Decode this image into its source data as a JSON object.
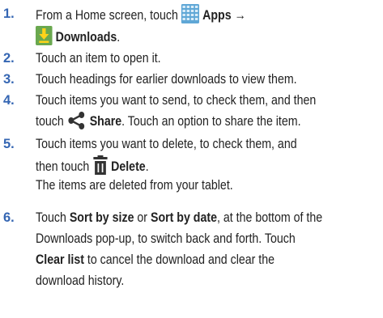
{
  "steps": [
    {
      "number": "1.",
      "l1": {
        "t1": "From a Home screen, touch ",
        "apps": "Apps",
        "arrow": " →"
      },
      "l2": {
        "downloads": "Downloads",
        "t2": "."
      }
    },
    {
      "number": "2.",
      "text": "Touch an item to open it."
    },
    {
      "number": "3.",
      "text": "Touch headings for earlier downloads to view them."
    },
    {
      "number": "4.",
      "l1": "Touch items you want to send, to check them, and then",
      "l2": {
        "t1": "touch ",
        "share": "Share",
        "t2": ". Touch an option to share the item."
      }
    },
    {
      "number": "5.",
      "l1": "Touch items you want to delete, to check them, and",
      "l2": {
        "t1": "then touch ",
        "delete": "Delete",
        "t2": "."
      },
      "l3": "The items are deleted from your tablet."
    },
    {
      "number": "6.",
      "l1": {
        "t1": "Touch ",
        "b1": "Sort by size",
        "t2": " or ",
        "b2": "Sort by date",
        "t3": ", at the bottom of the"
      },
      "l2": "Downloads pop-up, to switch back and forth. Touch",
      "l3": {
        "b1": "Clear list",
        "t1": " to cancel the download and clear the"
      },
      "l4": "download history."
    }
  ],
  "icons": {
    "apps": "apps-grid-icon",
    "downloads": "download-arrow-icon",
    "share": "share-icon",
    "delete": "trash-icon"
  },
  "colors": {
    "step_number": "#3566b3",
    "apps_icon": "#5fa7d6",
    "downloads_icon": "#6aa84f",
    "glyph_icon": "#333333"
  }
}
